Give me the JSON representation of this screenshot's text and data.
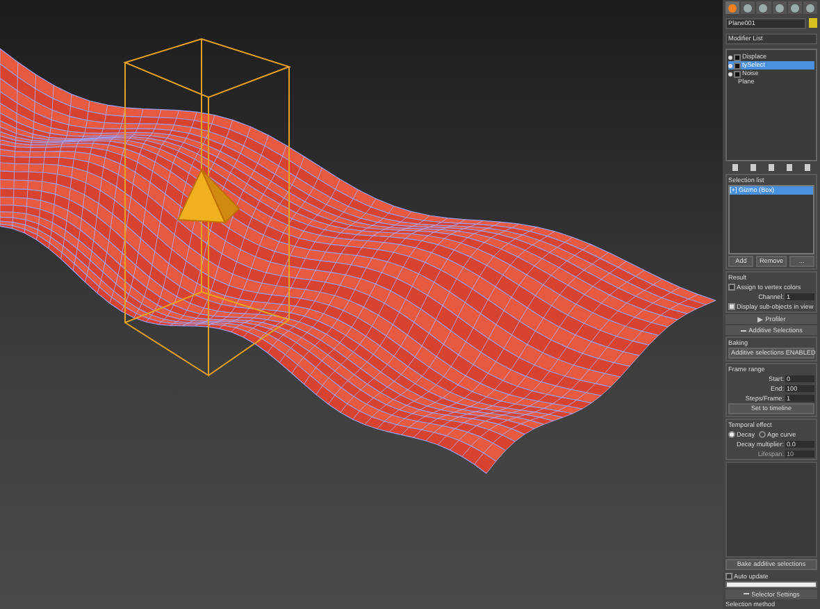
{
  "command_tabs": [
    {
      "selected": true
    },
    {
      "selected": false
    },
    {
      "selected": false
    },
    {
      "selected": false
    },
    {
      "selected": false
    },
    {
      "selected": false
    }
  ],
  "object_name": "Plane001",
  "modifier_list": "Modifier List",
  "stack": [
    {
      "label": "Displace",
      "selected": false,
      "kind": "modifier"
    },
    {
      "label": "tySelect",
      "selected": true,
      "kind": "modifier"
    },
    {
      "label": "Noise",
      "selected": false,
      "kind": "modifier"
    },
    {
      "label": "Plane",
      "selected": false,
      "kind": "base"
    }
  ],
  "selection_list": {
    "title": "Selection list",
    "items": [
      {
        "label": "[+] Gizmo (Box)",
        "selected": true
      }
    ],
    "buttons": [
      "Add",
      "Remove",
      "..."
    ]
  },
  "result": {
    "title": "Result",
    "assign": {
      "label": "Assign to vertex colors",
      "checked": false
    },
    "channel": {
      "label": "Channel:",
      "value": "1"
    },
    "display": {
      "label": "Display sub-objects in view",
      "checked": true
    }
  },
  "profiler": {
    "title": "Profiler",
    "expanded": false
  },
  "additive": {
    "title": "Additive Selections",
    "expanded": true,
    "baking_title": "Baking",
    "baking_button": "Additive selections ENABLED",
    "frame_range_title": "Frame range",
    "fields": [
      {
        "label": "Start:",
        "value": "0"
      },
      {
        "label": "End:",
        "value": "100"
      },
      {
        "label": "Steps/Frame:",
        "value": "1"
      }
    ],
    "timeline_button": "Set to timeline",
    "temporal_title": "Temporal effect",
    "radios": [
      {
        "label": "Decay",
        "selected": true
      },
      {
        "label": "Age curve",
        "selected": false
      }
    ],
    "decay": {
      "label": "Decay multiplier:",
      "value": "0.0"
    },
    "lifespan": {
      "label": "Lifespan:",
      "value": "10",
      "disabled": true
    },
    "bake_button": "Bake additive selections",
    "auto_update": {
      "label": "Auto update",
      "checked": false
    },
    "progress": {
      "level": 1
    }
  },
  "selector_settings": {
    "title": "Selector Settings",
    "expanded": true,
    "next_label": "Selection method"
  }
}
